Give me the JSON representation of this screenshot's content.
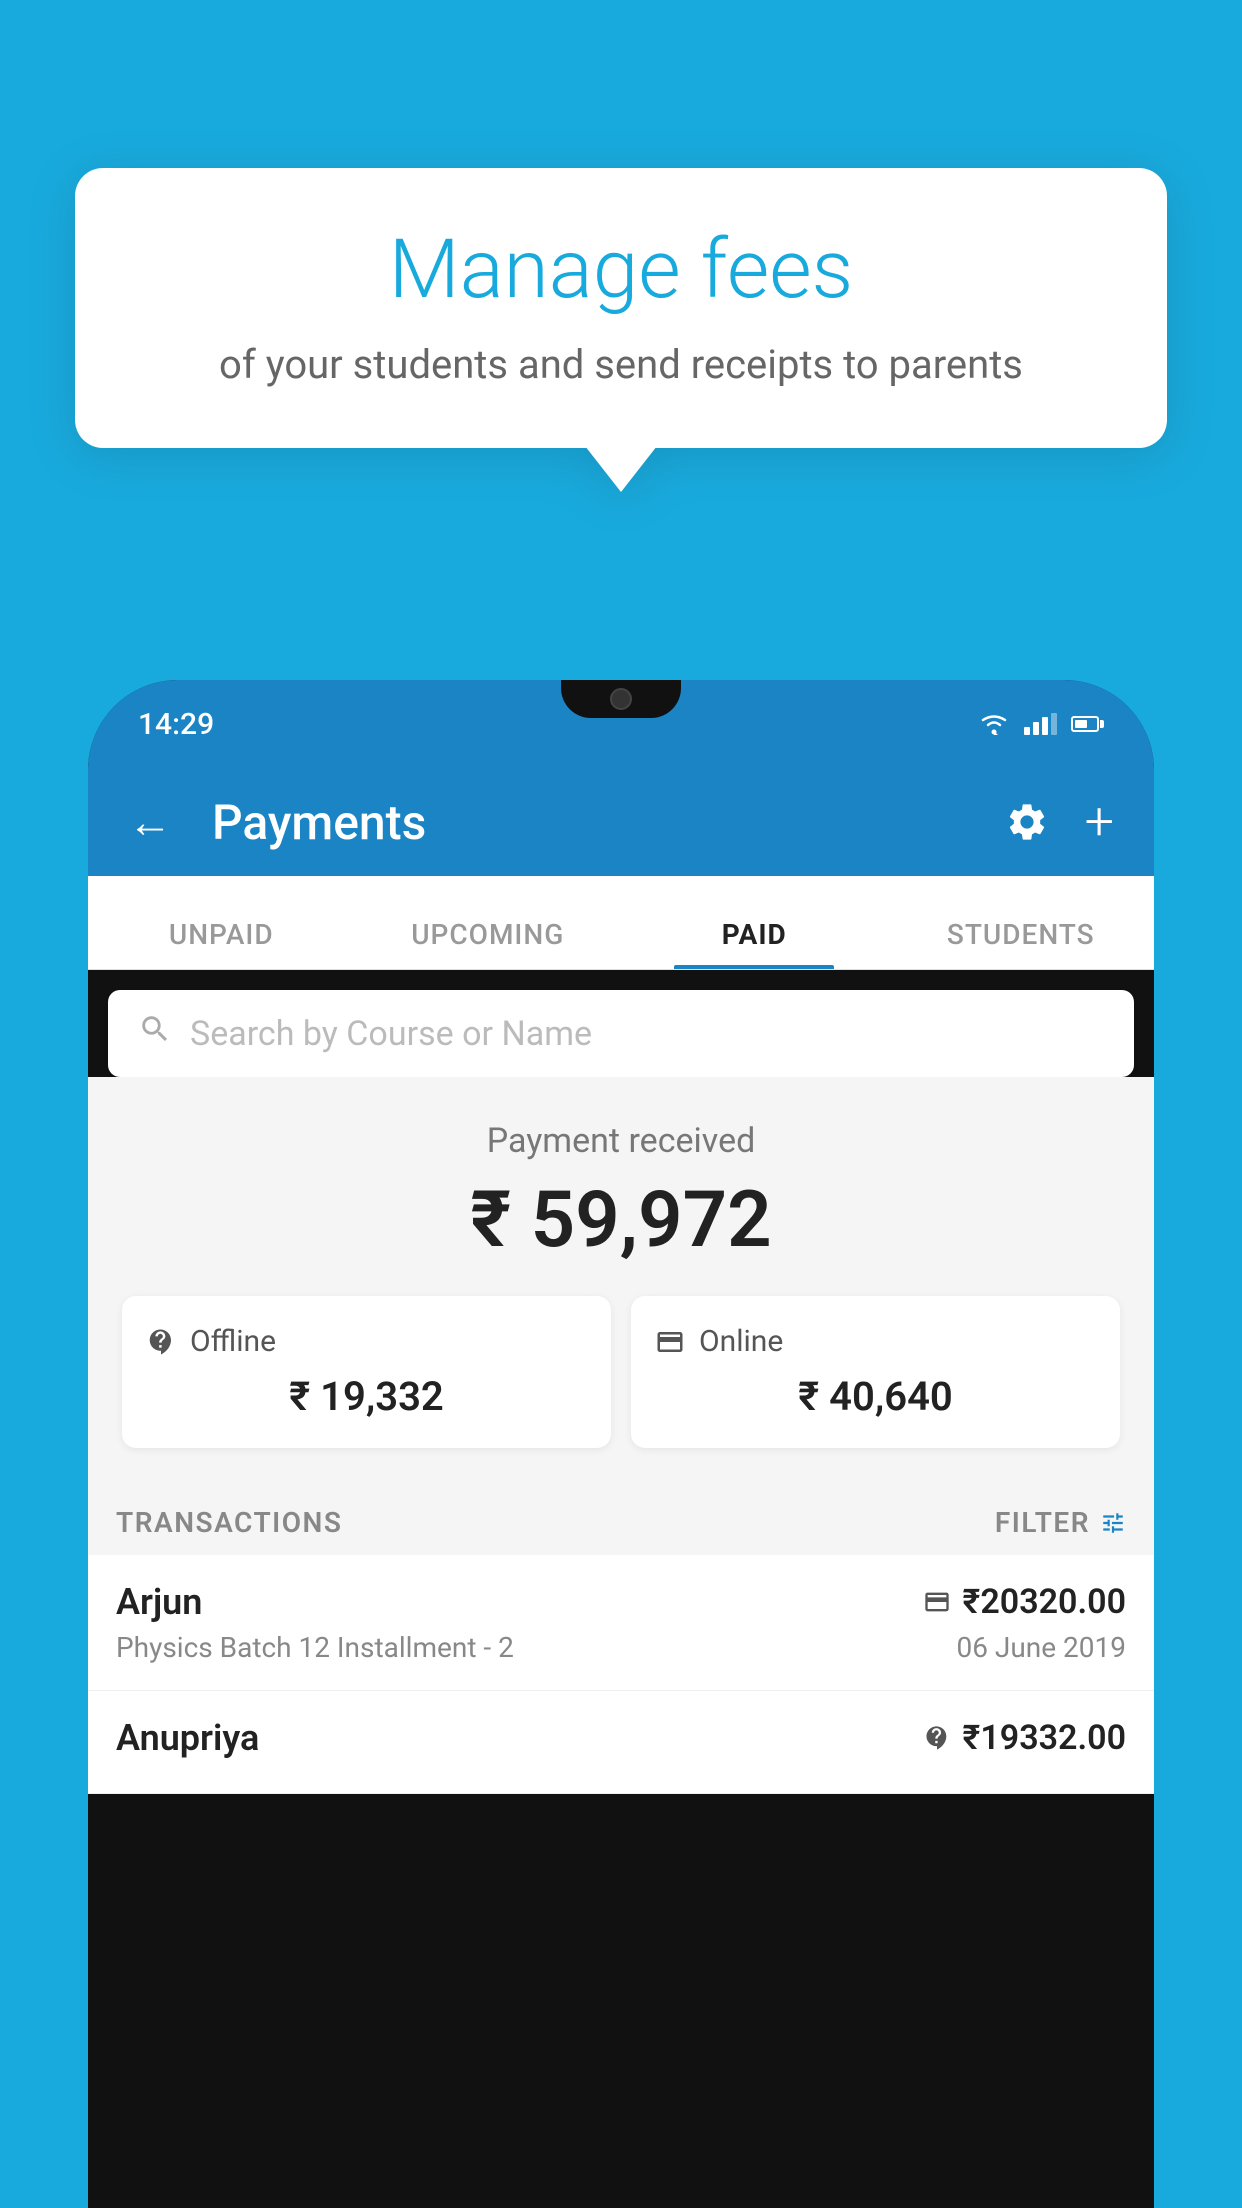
{
  "background_color": "#19AADD",
  "speech_bubble": {
    "title": "Manage fees",
    "subtitle": "of your students and send receipts to parents"
  },
  "phone": {
    "status_bar": {
      "time": "14:29"
    },
    "header": {
      "title": "Payments",
      "back_label": "←",
      "settings_label": "⚙",
      "add_label": "+"
    },
    "tabs": [
      {
        "label": "UNPAID",
        "active": false
      },
      {
        "label": "UPCOMING",
        "active": false
      },
      {
        "label": "PAID",
        "active": true
      },
      {
        "label": "STUDENTS",
        "active": false
      }
    ],
    "search": {
      "placeholder": "Search by Course or Name"
    },
    "payment_summary": {
      "label": "Payment received",
      "total": "₹ 59,972",
      "offline": {
        "type": "Offline",
        "amount": "₹ 19,332"
      },
      "online": {
        "type": "Online",
        "amount": "₹ 40,640"
      }
    },
    "transactions": {
      "header_label": "TRANSACTIONS",
      "filter_label": "FILTER",
      "items": [
        {
          "name": "Arjun",
          "course": "Physics Batch 12 Installment - 2",
          "amount": "₹20320.00",
          "date": "06 June 2019",
          "type": "online"
        },
        {
          "name": "Anupriya",
          "course": "",
          "amount": "₹19332.00",
          "date": "",
          "type": "offline"
        }
      ]
    }
  }
}
